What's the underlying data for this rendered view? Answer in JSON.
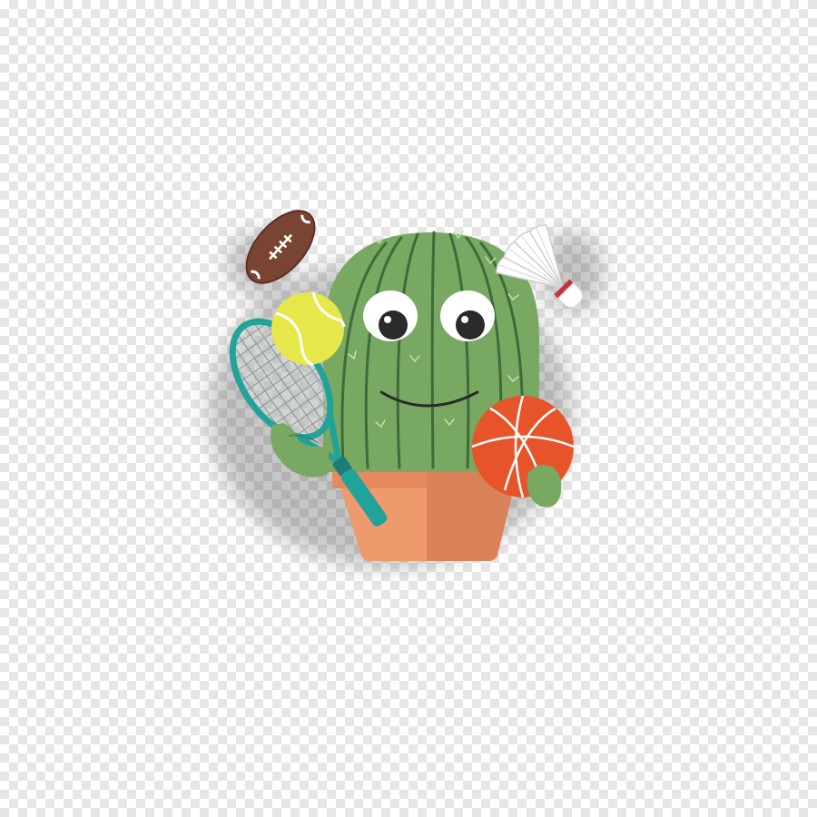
{
  "scene": {
    "kind": "illustration",
    "background": "transparency-checkerboard",
    "subject": "cactus-in-pot",
    "props": [
      "american-football",
      "tennis-ball",
      "tennis-racket",
      "basketball",
      "badminton-shuttlecock"
    ]
  },
  "colors": {
    "checker_light": "#ffffff",
    "checker_dark": "#e6e6e6",
    "cactus_green": "#78a862",
    "cactus_rib": "#3f6b3a",
    "pot_light": "#ef9a6c",
    "pot_dark": "#d9825a",
    "pot_rim": "#e58a5f",
    "football_brown": "#7a4434",
    "tennis_ball": "#e6e74a",
    "racket_teal": "#22a39a",
    "basketball_orange": "#e8542a",
    "shuttle_red": "#c8323a",
    "eye_white": "#ffffff",
    "pupil": "#2a2a2a"
  }
}
